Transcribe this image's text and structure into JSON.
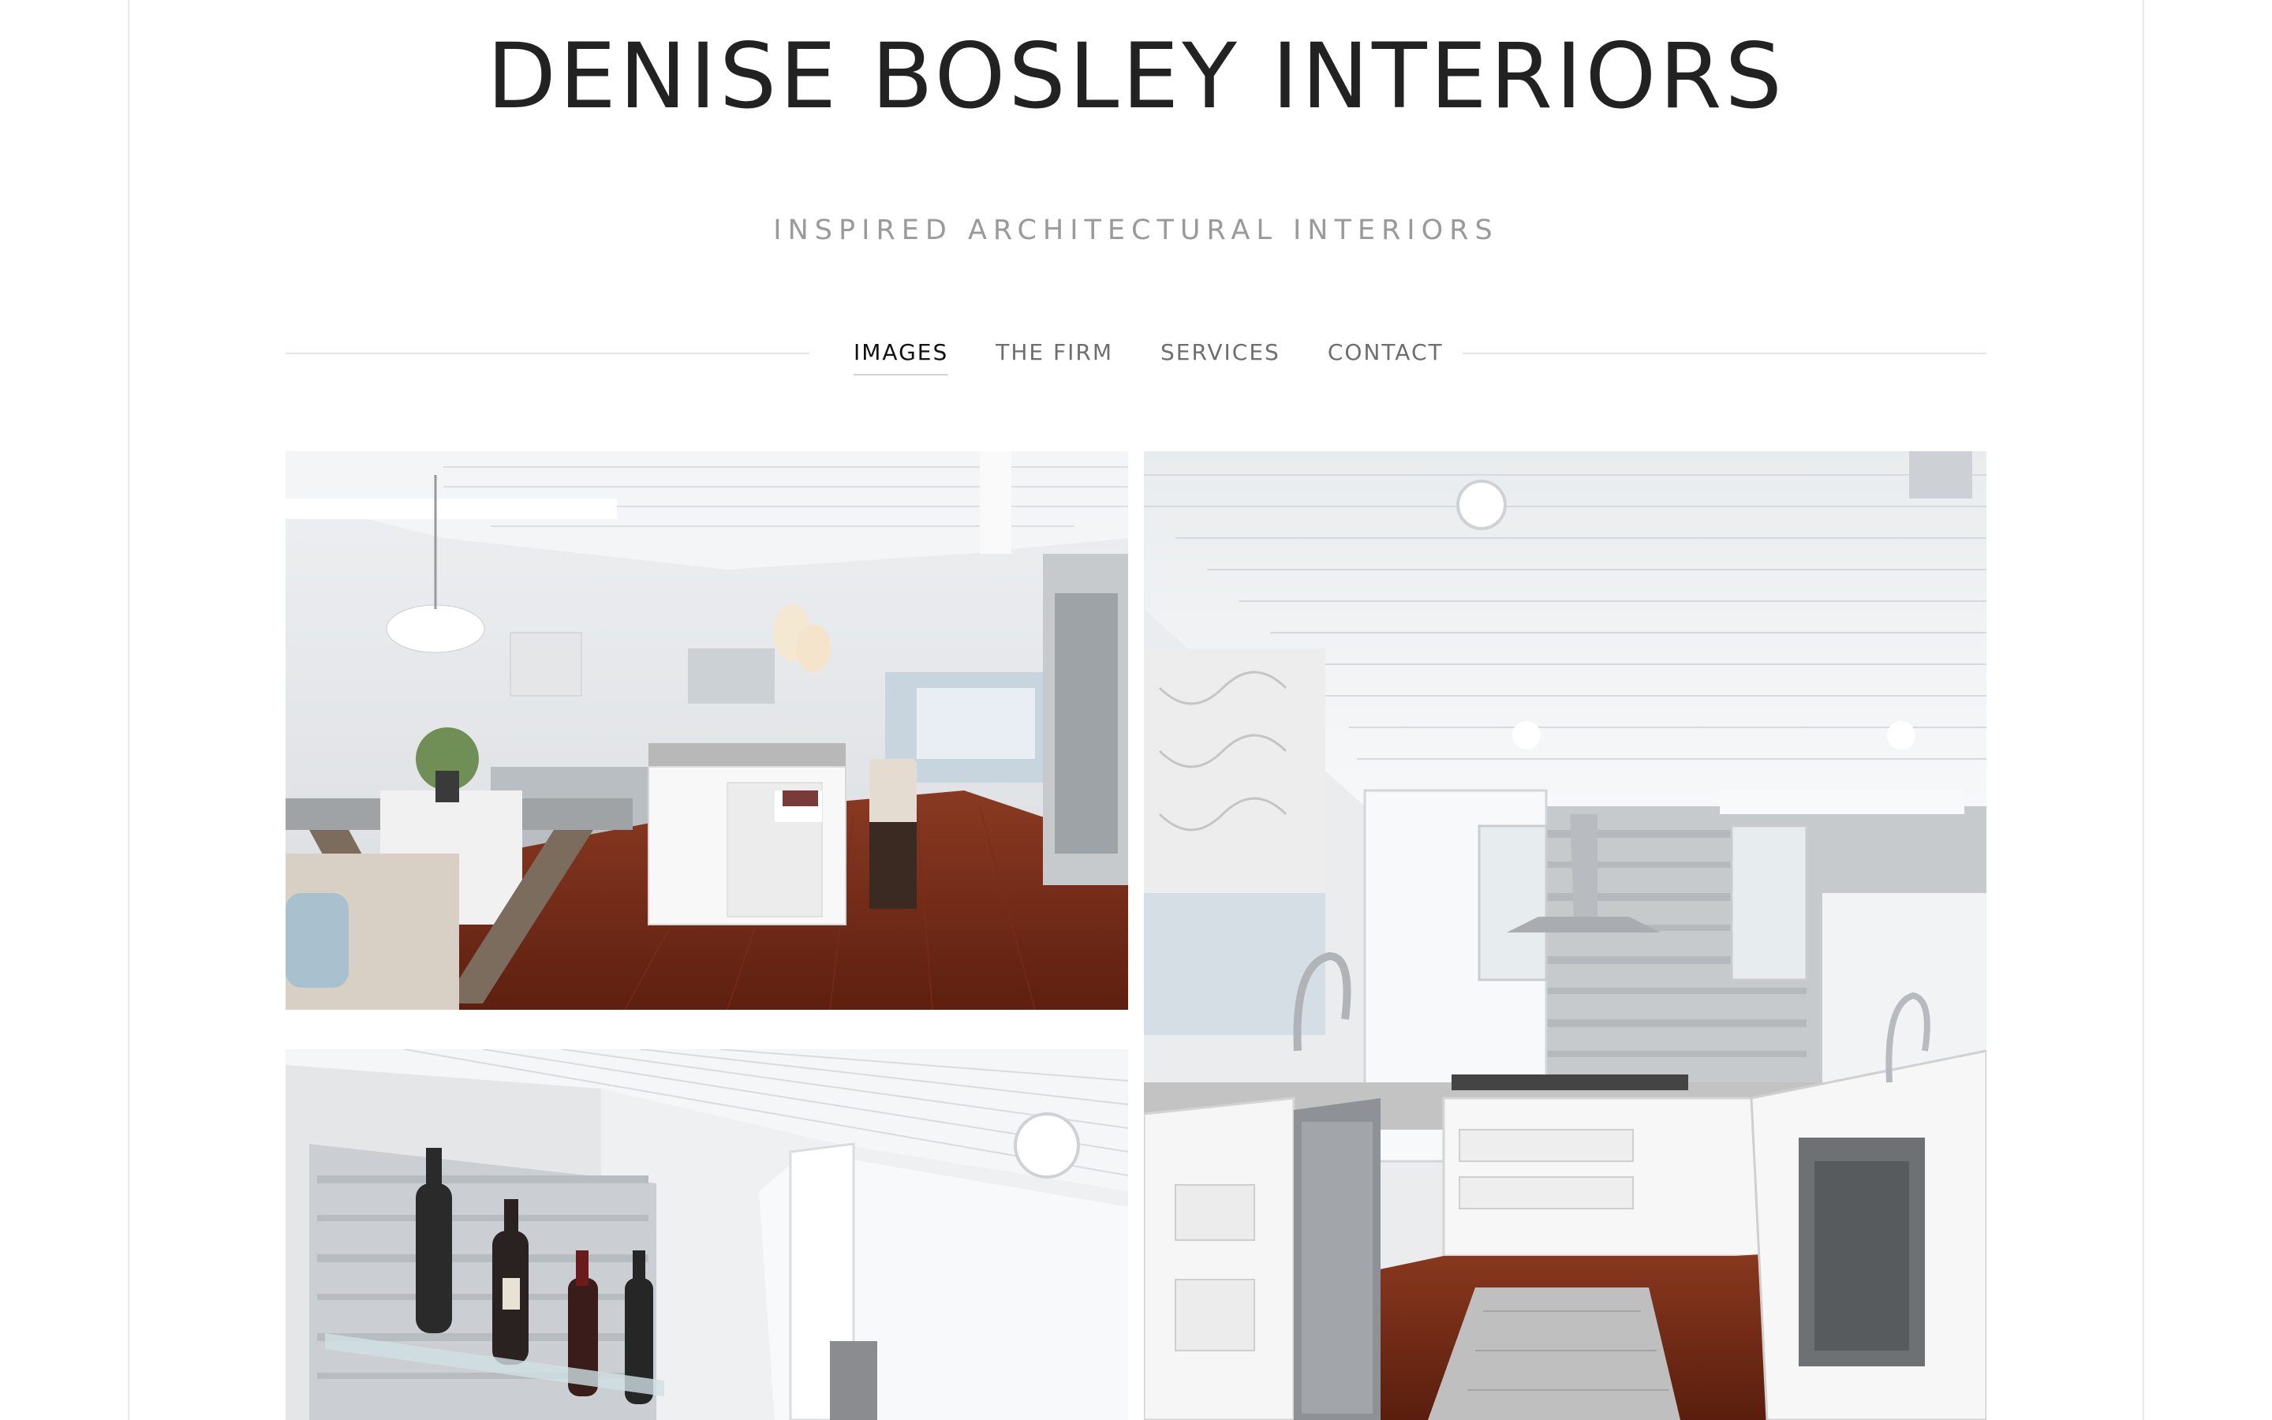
{
  "site": {
    "title": "DENISE BOSLEY INTERIORS",
    "tagline": "INSPIRED ARCHITECTURAL INTERIORS"
  },
  "nav": {
    "items": [
      {
        "label": "IMAGES",
        "active": true
      },
      {
        "label": "THE FIRM",
        "active": false
      },
      {
        "label": "SERVICES",
        "active": false
      },
      {
        "label": "CONTACT",
        "active": false
      }
    ]
  },
  "gallery": {
    "images": [
      {
        "subject": "kitchen-dining-room-photo"
      },
      {
        "subject": "kitchen-range-hood-photo"
      },
      {
        "subject": "wine-shelf-photo"
      }
    ]
  },
  "colors": {
    "title": "#222222",
    "tagline": "#9a9a9a",
    "nav_inactive": "#6e6e6e",
    "nav_active": "#111111",
    "divider": "#e6e6e6"
  }
}
